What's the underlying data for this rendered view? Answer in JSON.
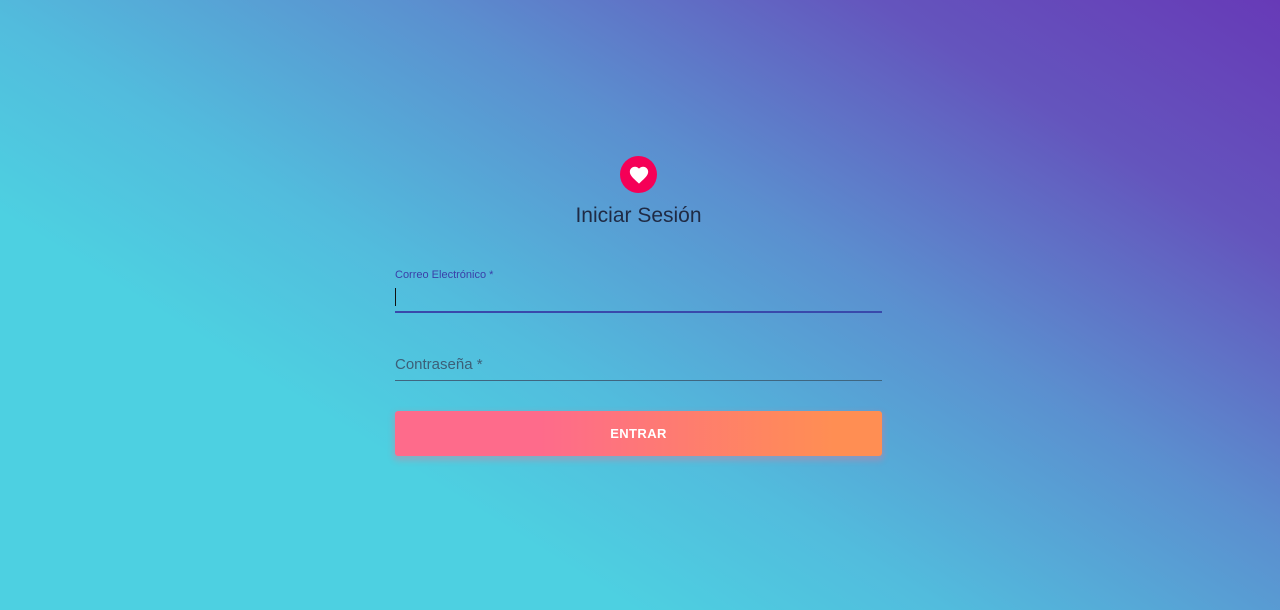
{
  "login": {
    "icon": "heart-icon",
    "title": "Iniciar Sesión",
    "email": {
      "label": "Correo Electrónico *",
      "value": "",
      "focused": true
    },
    "password": {
      "label": "Contraseña *",
      "value": ""
    },
    "submit_label": "ENTRAR"
  },
  "colors": {
    "gradient_start": "#4dd0e1",
    "gradient_end": "#673ab7",
    "avatar_bg": "#f50057",
    "button_gradient_start": "#fe6b8b",
    "button_gradient_end": "#ff8e53",
    "focus_underline": "#3949ab"
  }
}
